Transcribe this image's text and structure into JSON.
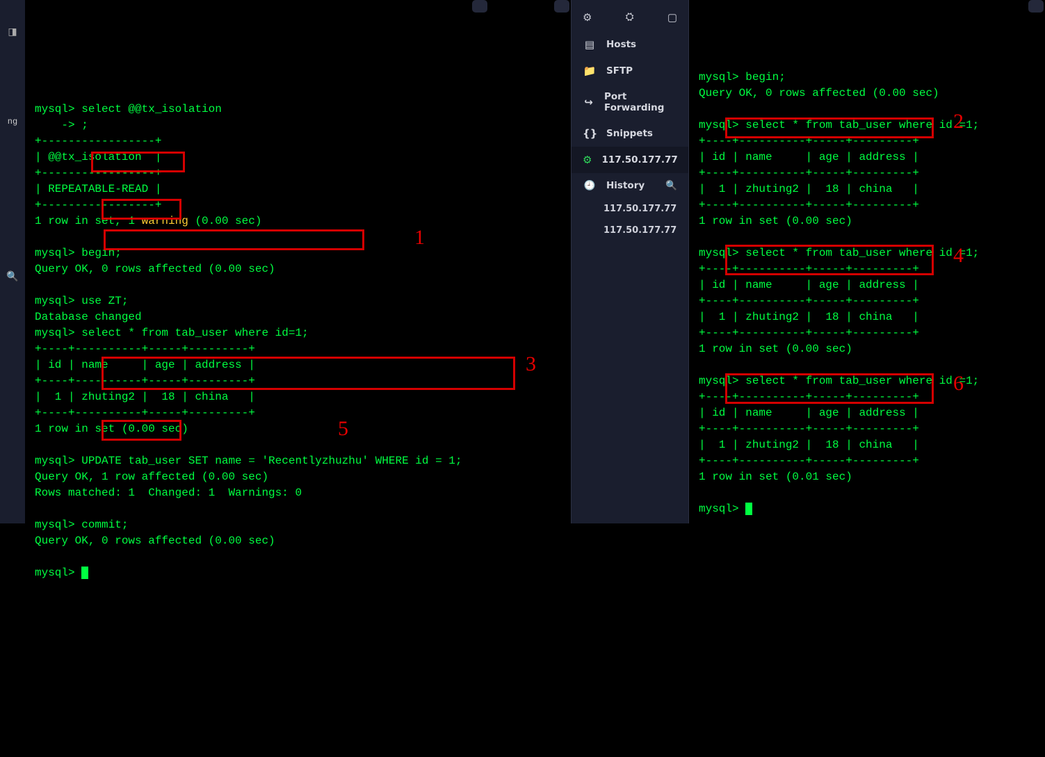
{
  "left_gutter": {
    "icon1": "◨",
    "label_cut": "ng",
    "icon2": "🔍"
  },
  "mid_panel": {
    "top_icons": {
      "gear": "⚙",
      "cols": "⛭",
      "card": "▢"
    },
    "items": [
      {
        "icon": "▤",
        "label": "Hosts"
      },
      {
        "icon": "📁",
        "label": "SFTP"
      },
      {
        "icon": "↪",
        "label": "Port Forwarding"
      },
      {
        "icon": "{}",
        "label": "Snippets"
      }
    ],
    "active": {
      "icon": "⚙",
      "label": "117.50.177.77"
    },
    "history": {
      "icon": "🕘",
      "label": "History",
      "search": "🔍"
    },
    "sub_items": [
      "117.50.177.77",
      "117.50.177.77"
    ]
  },
  "terminal_left": {
    "lines": [
      {
        "t": "mysql> select @@tx_isolation"
      },
      {
        "t": "    -> ;"
      },
      {
        "t": "+-----------------+"
      },
      {
        "t": "| @@tx_isolation  |"
      },
      {
        "t": "+-----------------+"
      },
      {
        "t": "| REPEATABLE-READ |"
      },
      {
        "t": "+-----------------+"
      },
      {
        "pre": "1 row in set, 1 ",
        "warn": "warning",
        "post": " (0.00 sec)"
      },
      {
        "t": ""
      },
      {
        "t": "mysql> begin;"
      },
      {
        "t": "Query OK, 0 rows affected (0.00 sec)"
      },
      {
        "t": ""
      },
      {
        "t": "mysql> use ZT;"
      },
      {
        "t": "Database changed"
      },
      {
        "t": "mysql> select * from tab_user where id=1;"
      },
      {
        "t": "+----+----------+-----+---------+"
      },
      {
        "t": "| id | name     | age | address |"
      },
      {
        "t": "+----+----------+-----+---------+"
      },
      {
        "t": "|  1 | zhuting2 |  18 | china   |"
      },
      {
        "t": "+----+----------+-----+---------+"
      },
      {
        "t": "1 row in set (0.00 sec)"
      },
      {
        "t": ""
      },
      {
        "t": "mysql> UPDATE tab_user SET name = 'Recentlyzhuzhu' WHERE id = 1;"
      },
      {
        "t": "Query OK, 1 row affected (0.00 sec)"
      },
      {
        "t": "Rows matched: 1  Changed: 1  Warnings: 0"
      },
      {
        "t": ""
      },
      {
        "t": "mysql> commit;"
      },
      {
        "t": "Query OK, 0 rows affected (0.00 sec)"
      },
      {
        "t": ""
      },
      {
        "t": "mysql> "
      }
    ],
    "annot": {
      "a1": "1",
      "a3": "3",
      "a5": "5"
    }
  },
  "terminal_right": {
    "lines": [
      "mysql> begin;",
      "Query OK, 0 rows affected (0.00 sec)",
      "",
      "mysql> select * from tab_user where id =1;",
      "+----+----------+-----+---------+",
      "| id | name     | age | address |",
      "+----+----------+-----+---------+",
      "|  1 | zhuting2 |  18 | china   |",
      "+----+----------+-----+---------+",
      "1 row in set (0.00 sec)",
      "",
      "mysql> select * from tab_user where id =1;",
      "+----+----------+-----+---------+",
      "| id | name     | age | address |",
      "+----+----------+-----+---------+",
      "|  1 | zhuting2 |  18 | china   |",
      "+----+----------+-----+---------+",
      "1 row in set (0.00 sec)",
      "",
      "mysql> select * from tab_user where id =1;",
      "+----+----------+-----+---------+",
      "| id | name     | age | address |",
      "+----+----------+-----+---------+",
      "|  1 | zhuting2 |  18 | china   |",
      "+----+----------+-----+---------+",
      "1 row in set (0.01 sec)",
      "",
      "mysql> "
    ],
    "annot": {
      "a2": "2",
      "a4": "4",
      "a6": "6"
    }
  }
}
